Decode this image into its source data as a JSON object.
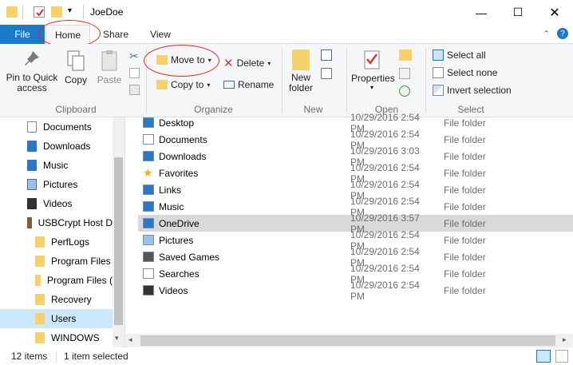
{
  "window": {
    "title": "JoeDoe"
  },
  "tabs": {
    "file": "File",
    "home": "Home",
    "share": "Share",
    "view": "View"
  },
  "ribbon": {
    "pin_label": "Pin to Quick access",
    "copy_label": "Copy",
    "paste_label": "Paste",
    "move_to": "Move to",
    "copy_to": "Copy to",
    "delete": "Delete",
    "rename": "Rename",
    "new_folder": "New folder",
    "properties": "Properties",
    "select_all": "Select all",
    "select_none": "Select none",
    "invert_selection": "Invert selection",
    "groups": {
      "clipboard": "Clipboard",
      "organize": "Organize",
      "new": "New",
      "open": "Open",
      "select": "Select"
    }
  },
  "nav": {
    "items": [
      {
        "label": "Documents",
        "icon": "documents-icon"
      },
      {
        "label": "Downloads",
        "icon": "download-icon"
      },
      {
        "label": "Music",
        "icon": "music-icon"
      },
      {
        "label": "Pictures",
        "icon": "pictures-icon"
      },
      {
        "label": "Videos",
        "icon": "videos-icon"
      },
      {
        "label": "USBCrypt Host D",
        "icon": "drive-icon"
      },
      {
        "label": "PerfLogs",
        "icon": "folder-icon"
      },
      {
        "label": "Program Files",
        "icon": "folder-icon"
      },
      {
        "label": "Program Files (",
        "icon": "folder-icon"
      },
      {
        "label": "Recovery",
        "icon": "folder-icon"
      },
      {
        "label": "Users",
        "icon": "folder-icon"
      },
      {
        "label": "WINDOWS",
        "icon": "folder-icon"
      }
    ]
  },
  "files": [
    {
      "name": "Desktop",
      "date": "10/29/2016 2:54 PM",
      "type": "File folder",
      "icon": "desktop-icon"
    },
    {
      "name": "Documents",
      "date": "10/29/2016 2:54 PM",
      "type": "File folder",
      "icon": "documents-icon"
    },
    {
      "name": "Downloads",
      "date": "10/29/2016 3:03 PM",
      "type": "File folder",
      "icon": "download-icon"
    },
    {
      "name": "Favorites",
      "date": "10/29/2016 2:54 PM",
      "type": "File folder",
      "icon": "star-icon"
    },
    {
      "name": "Links",
      "date": "10/29/2016 2:54 PM",
      "type": "File folder",
      "icon": "link-icon"
    },
    {
      "name": "Music",
      "date": "10/29/2016 2:54 PM",
      "type": "File folder",
      "icon": "music-icon"
    },
    {
      "name": "OneDrive",
      "date": "10/29/2016 3:57 PM",
      "type": "File folder",
      "icon": "cloud-icon"
    },
    {
      "name": "Pictures",
      "date": "10/29/2016 2:54 PM",
      "type": "File folder",
      "icon": "pictures-icon"
    },
    {
      "name": "Saved Games",
      "date": "10/29/2016 2:54 PM",
      "type": "File folder",
      "icon": "games-icon"
    },
    {
      "name": "Searches",
      "date": "10/29/2016 2:54 PM",
      "type": "File folder",
      "icon": "search-icon"
    },
    {
      "name": "Videos",
      "date": "10/29/2016 2:54 PM",
      "type": "File folder",
      "icon": "videos-icon"
    }
  ],
  "status": {
    "count": "12 items",
    "selected": "1 item selected"
  },
  "colors": {
    "file_tab": "#1979ca",
    "selected_row": "#d9d9d9",
    "nav_selected": "#cce8ff",
    "annotation": "#e1261c"
  }
}
